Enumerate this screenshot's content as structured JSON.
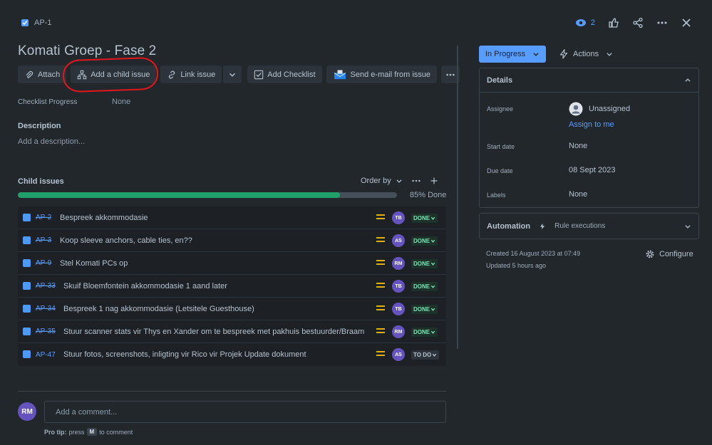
{
  "header": {
    "issue_key": "AP-1",
    "watch_count": "2",
    "title": "Komati Groep - Fase 2"
  },
  "toolbar": {
    "attach": "Attach",
    "add_child": "Add a child issue",
    "link_issue": "Link issue",
    "add_checklist": "Add Checklist",
    "send_email": "Send e-mail from issue"
  },
  "fields": {
    "checklist_progress_label": "Checklist Progress",
    "checklist_progress_value": "None",
    "description_label": "Description",
    "description_placeholder": "Add a description..."
  },
  "child_issues": {
    "label": "Child issues",
    "order_by": "Order by",
    "progress_text": "85% Done",
    "progress_fraction": 0.85,
    "rows": [
      {
        "key": "AP-2",
        "summary": "Bespreek akkommodasie",
        "assignee": "TB",
        "status": "DONE",
        "done": true
      },
      {
        "key": "AP-3",
        "summary": "Koop sleeve anchors, cable ties, en??",
        "assignee": "AS",
        "status": "DONE",
        "done": true
      },
      {
        "key": "AP-9",
        "summary": "Stel Komati PCs op",
        "assignee": "RM",
        "status": "DONE",
        "done": true
      },
      {
        "key": "AP-33",
        "summary": "Skuif Bloemfontein akkommodasie 1 aand later",
        "assignee": "TB",
        "status": "DONE",
        "done": true
      },
      {
        "key": "AP-34",
        "summary": "Bespreek 1 nag akkommodasie (Letsitele Guesthouse)",
        "assignee": "TB",
        "status": "DONE",
        "done": true
      },
      {
        "key": "AP-35",
        "summary": "Stuur scanner stats vir Thys en Xander om te bespreek met pakhuis bestuurder/Braam",
        "assignee": "RM",
        "status": "DONE",
        "done": true
      },
      {
        "key": "AP-47",
        "summary": "Stuur fotos, screenshots, inligting vir Rico vir Projek Update dokument",
        "assignee": "AS",
        "status": "TO DO",
        "done": false
      }
    ]
  },
  "comment": {
    "avatar": "RM",
    "placeholder": "Add a comment...",
    "protip_label": "Pro tip:",
    "protip_press": "press",
    "protip_key": "M",
    "protip_rest": "to comment"
  },
  "sidebar": {
    "status": "In Progress",
    "actions": "Actions",
    "details_title": "Details",
    "assignee_label": "Assignee",
    "assignee_value": "Unassigned",
    "assign_to_me": "Assign to me",
    "start_date_label": "Start date",
    "start_date_value": "None",
    "due_date_label": "Due date",
    "due_date_value": "08 Sept 2023",
    "labels_label": "Labels",
    "labels_value": "None",
    "automation_title": "Automation",
    "rule_executions": "Rule executions",
    "created": "Created 16 August 2023 at 07:49",
    "updated": "Updated 5 hours ago",
    "configure": "Configure"
  },
  "colors": {
    "accent": "#579dff",
    "progress": "#22a06b",
    "priority_medium": "#e2b203",
    "annotation": "#e2161c"
  }
}
